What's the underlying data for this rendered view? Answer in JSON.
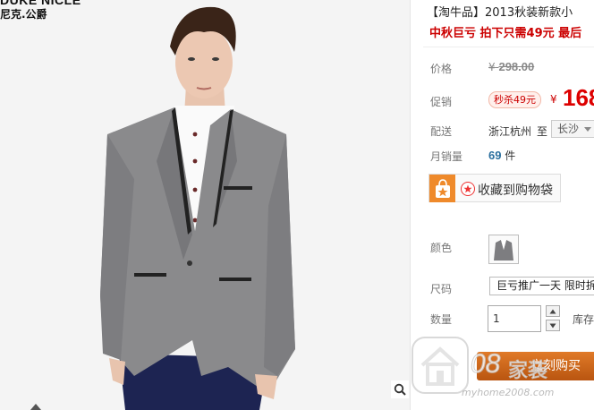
{
  "brand": {
    "name_en": "DUKE NICLE",
    "name_cn": "尼克.公爵"
  },
  "product": {
    "title": "【淘牛品】2013秋装新款小",
    "subtitle": "中秋巨亏 拍下只需49元 最后"
  },
  "price": {
    "label": "价格",
    "currency": "¥",
    "original": "298.00"
  },
  "promotion": {
    "label": "促销",
    "badge": "秒杀49元",
    "currency": "¥",
    "price": "168"
  },
  "shipping": {
    "label": "配送",
    "from": "浙江杭州",
    "to": "至",
    "city": "长沙"
  },
  "sales": {
    "label": "月销量",
    "count": "69",
    "unit": "件"
  },
  "cart": {
    "label": "收藏到购物袋"
  },
  "sku": {
    "color_label": "颜色",
    "size_label": "尺码",
    "size_option": "巨亏推广一天 限时拆"
  },
  "quantity": {
    "label": "数量",
    "value": "1",
    "stock_label": "库存"
  },
  "buy": {
    "label": "立刻购买"
  },
  "watermark": {
    "brand_number": "08",
    "brand_text": "家装",
    "url": "myhome2008.com"
  },
  "colors": {
    "accent_red": "#cc0000",
    "buy_orange": "#c66a1a",
    "cart_orange": "#ef8a2b"
  },
  "icons": [
    "zoom-icon",
    "shopping-bag-icon",
    "star-icon",
    "chevron-down-icon",
    "arrow-up-icon",
    "arrow-down-icon",
    "house-icon"
  ]
}
